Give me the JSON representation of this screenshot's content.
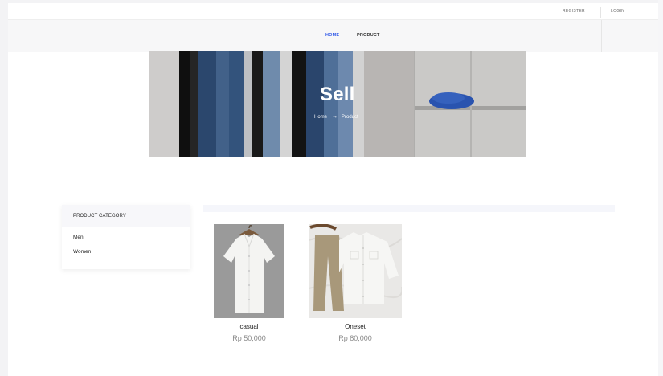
{
  "header": {
    "register_label": "REGISTER",
    "login_label": "LOGIN"
  },
  "nav": {
    "home_label": "HOME",
    "product_label": "PRODUCT"
  },
  "hero": {
    "title": "Sell",
    "breadcrumb_home": "Home",
    "breadcrumb_arrow": "→",
    "breadcrumb_current": "Product"
  },
  "sidebar": {
    "title": "PRODUCT CATEGORY",
    "categories": [
      "Men",
      "Women"
    ]
  },
  "products": [
    {
      "name": "casual",
      "price": "Rp 50,000",
      "image": "white-shirt-on-hanger"
    },
    {
      "name": "Oneset",
      "price": "Rp 80,000",
      "image": "white-jacket-and-khaki-pants"
    }
  ],
  "colors": {
    "nav_active": "#2f58e8",
    "price_gray": "#888888",
    "panel_bg": "#f7f7fa"
  }
}
